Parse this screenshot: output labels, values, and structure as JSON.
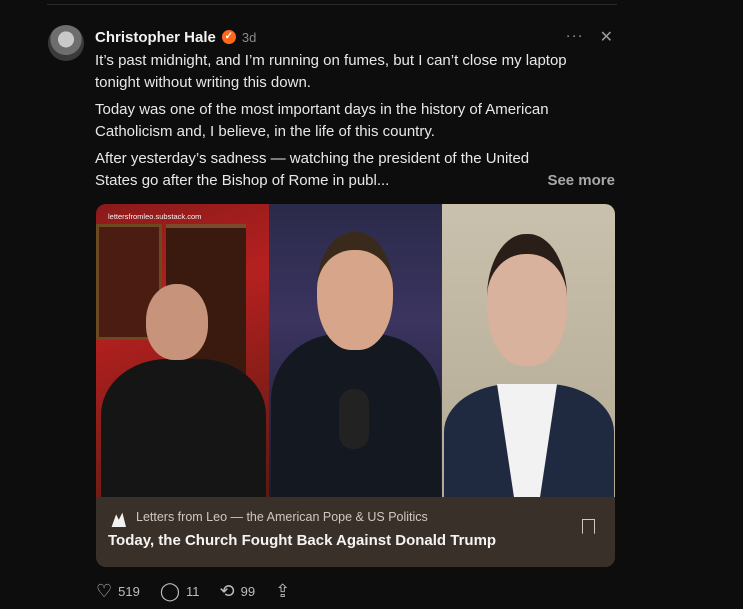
{
  "post": {
    "author": "Christopher Hale",
    "time": "3d",
    "paragraphs": [
      "It’s past midnight, and I’m running on fumes, but I can’t close my laptop tonight without writing this down.",
      "Today was one of the most important days in the history of American Catholicism and, I believe, in the life of this country.",
      "After yesterday’s sadness — watching the president of the United States go after the Bishop of Rome in publ..."
    ],
    "see_more": "See more"
  },
  "card": {
    "watermark": "lettersfromleo.substack.com",
    "publication": "Letters from Leo — the American Pope & US Politics",
    "title": "Today, the Church Fought Back Against Donald Trump"
  },
  "stats": {
    "likes": "519",
    "comments": "11",
    "restacks": "99"
  },
  "icons": {
    "verified": "verified-icon",
    "more": "more-icon",
    "close": "close-icon",
    "like": "heart-icon",
    "comment": "comment-icon",
    "restack": "restack-icon",
    "share": "share-icon",
    "bookmark": "bookmark-icon"
  },
  "colors": {
    "accent": "#ff6719",
    "background": "#0d0d0d",
    "card_footer": "#3a302a"
  }
}
